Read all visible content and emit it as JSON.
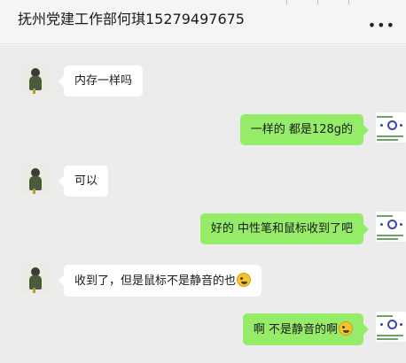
{
  "header": {
    "title": "抚州党建工作部何琪15279497675",
    "more_icon": "more-dots-icon",
    "more_glyph": "•••"
  },
  "messages": [
    {
      "side": "left",
      "text": "内存一样吗"
    },
    {
      "side": "right",
      "text": "一样的  都是128g的"
    },
    {
      "side": "left",
      "text": "可以"
    },
    {
      "side": "right",
      "text": "好的 中性笔和鼠标收到了吧"
    },
    {
      "side": "left",
      "text": "收到了，但是鼠标不是静音的也",
      "emoji": "laughing-crying-emoji"
    },
    {
      "side": "right",
      "text": "啊 不是静音的啊",
      "emoji": "laughing-crying-emoji"
    }
  ],
  "colors": {
    "sent_bubble": "#95ec69",
    "received_bubble": "#ffffff",
    "chat_background": "#ececec"
  }
}
